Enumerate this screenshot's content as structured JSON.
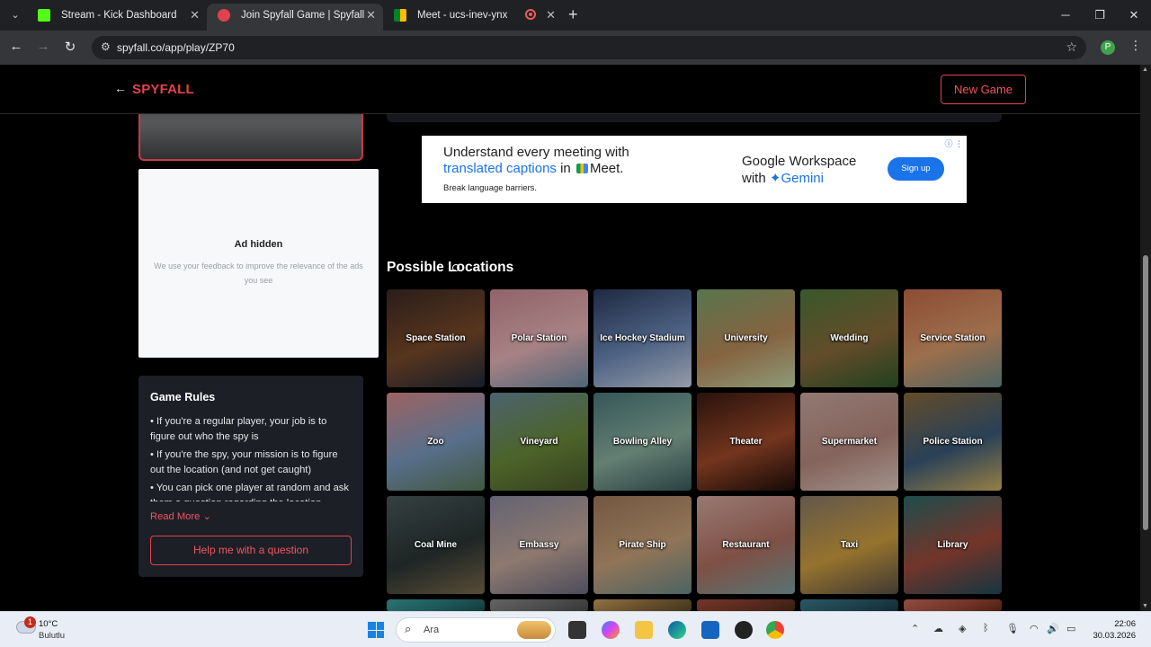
{
  "browser": {
    "tabs": [
      {
        "title": "Stream - Kick Dashboard",
        "icon": "kick-icon",
        "color": "#53fc18",
        "active": false
      },
      {
        "title": "Join Spyfall Game | Spyfall Onli",
        "icon": "spyfall-icon",
        "color": "#e1424d",
        "active": true
      },
      {
        "title": "Meet - ucs-inev-ynx",
        "icon": "meet-icon",
        "color": "#00832d",
        "active": false
      }
    ],
    "url": "spyfall.co/app/play/ZP70",
    "profile_initial": "P"
  },
  "site": {
    "logo": "SPYFALL",
    "new_game_label": "New Game",
    "accent": "#e1424d"
  },
  "ad_hidden": {
    "title": "Ad hidden",
    "subtitle": "We use your feedback to improve the relevance of the ads you see"
  },
  "rules": {
    "title": "Game Rules",
    "items": [
      "• If you're a regular player, your job is to figure out who the spy is",
      "• If you're the spy, your mission is to figure out the location (and not get caught)",
      "• You can pick one player at random and ask them a question regarding the location"
    ],
    "read_more": "Read More",
    "help_button": "Help me with a question"
  },
  "ad_banner": {
    "line1": "Understand every meeting with",
    "line2_link": "translated captions",
    "line2_rest": "in",
    "line2_brand": "Meet.",
    "line3": "Break language barriers.",
    "right1": "Google Workspace",
    "right2_pre": "with",
    "right2_brand": "Gemini",
    "cta": "Sign up"
  },
  "locations": {
    "title": "Possible Locations",
    "items": [
      {
        "name": "Space Station",
        "colors": [
          "#3a2a24",
          "#7a4a2a",
          "#1f2a3a"
        ]
      },
      {
        "name": "Polar Station",
        "colors": [
          "#c98a92",
          "#e8b4b8",
          "#6d8da6"
        ]
      },
      {
        "name": "Ice Hockey Stadium",
        "colors": [
          "#2b3a5a",
          "#6b89b8",
          "#d0d8e8"
        ]
      },
      {
        "name": "University",
        "colors": [
          "#7aa36a",
          "#b98a5a",
          "#c5d6a6"
        ]
      },
      {
        "name": "Wedding",
        "colors": [
          "#4f7a3c",
          "#8a6a3a",
          "#2f5a2c"
        ]
      },
      {
        "name": "Service Station",
        "colors": [
          "#c46a4a",
          "#d99a6a",
          "#6a8a8a"
        ]
      },
      {
        "name": "Zoo",
        "colors": [
          "#d98a8a",
          "#7a9ac0",
          "#5a7a5a"
        ]
      },
      {
        "name": "Vineyard",
        "colors": [
          "#6a8a9a",
          "#6a8a3a",
          "#4a5a2a"
        ]
      },
      {
        "name": "Bowling Alley",
        "colors": [
          "#4a7a7a",
          "#8ab0a0",
          "#3a5a5a"
        ]
      },
      {
        "name": "Theater",
        "colors": [
          "#3a1a12",
          "#a04a2a",
          "#1e0e0a"
        ]
      },
      {
        "name": "Supermarket",
        "colors": [
          "#c9a8a0",
          "#b88a80",
          "#e0cac0"
        ]
      },
      {
        "name": "Police Station",
        "colors": [
          "#8a6a3a",
          "#3a5a7a",
          "#d0b060"
        ]
      },
      {
        "name": "Coal Mine",
        "colors": [
          "#4a5a5a",
          "#2a3434",
          "#7a6a4a"
        ]
      },
      {
        "name": "Embassy",
        "colors": [
          "#8a8aa0",
          "#c4a89a",
          "#6a6a80"
        ]
      },
      {
        "name": "Pirate Ship",
        "colors": [
          "#a07a5a",
          "#c9a27a",
          "#6a8a8a"
        ]
      },
      {
        "name": "Restaurant",
        "colors": [
          "#d4a8a0",
          "#b07060",
          "#7aa0a0"
        ]
      },
      {
        "name": "Taxi",
        "colors": [
          "#8a7a6a",
          "#d0a040",
          "#5a5048"
        ]
      },
      {
        "name": "Library",
        "colors": [
          "#2a6a6a",
          "#a04a3a",
          "#1e4a5a"
        ]
      },
      {
        "name": "",
        "colors": [
          "#3aa0a0",
          "#2a7a7a",
          "#1a5050"
        ]
      },
      {
        "name": "",
        "colors": [
          "#8a8a8a",
          "#6a6a6a",
          "#4a4a4a"
        ]
      },
      {
        "name": "",
        "colors": [
          "#c9a060",
          "#8a6a3a",
          "#5a4a2a"
        ]
      },
      {
        "name": "",
        "colors": [
          "#a04a3a",
          "#7a3a2a",
          "#4a2a1a"
        ]
      },
      {
        "name": "",
        "colors": [
          "#3a7a8a",
          "#2a5a6a",
          "#1a3a4a"
        ]
      },
      {
        "name": "",
        "colors": [
          "#c96a5a",
          "#a04a3a",
          "#6a2a1a"
        ]
      }
    ]
  },
  "taskbar": {
    "weather_badge": "1",
    "temperature": "10°C",
    "weather": "Bulutlu",
    "search_placeholder": "Ara",
    "time": "22:06",
    "date": "30.03.2026"
  }
}
